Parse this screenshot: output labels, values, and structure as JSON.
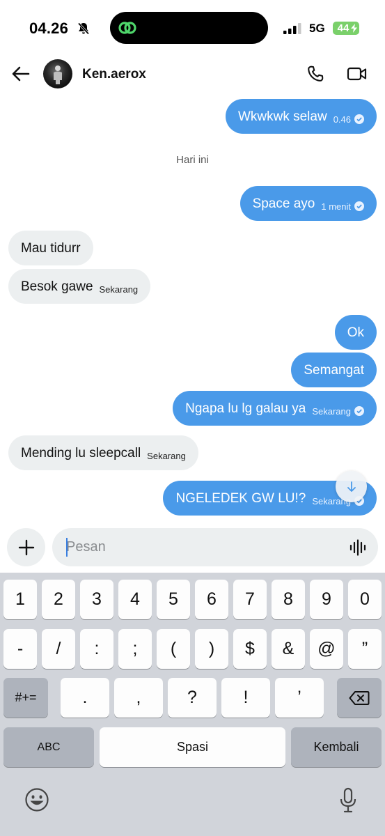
{
  "status_bar": {
    "time": "04.26",
    "network": "5G",
    "battery": "44"
  },
  "header": {
    "contact_name": "Ken.aerox"
  },
  "messages": [
    {
      "dir": "out",
      "text": "Wkwkwk selaw",
      "meta": "0.46",
      "check": true
    },
    {
      "dir": "out",
      "text": "Space ayo",
      "meta": "1 menit",
      "check": true
    },
    {
      "dir": "in",
      "text": "Mau tidurr",
      "meta": "",
      "check": false
    },
    {
      "dir": "in",
      "text": "Besok gawe",
      "meta": "Sekarang",
      "check": false
    },
    {
      "dir": "out",
      "text": "Ok",
      "meta": "",
      "check": false
    },
    {
      "dir": "out",
      "text": "Semangat",
      "meta": "",
      "check": false
    },
    {
      "dir": "out",
      "text": "Ngapa lu lg galau ya",
      "meta": "Sekarang",
      "check": true
    },
    {
      "dir": "in",
      "text": "Mending lu sleepcall",
      "meta": "Sekarang",
      "check": false
    },
    {
      "dir": "out",
      "text": "NGELEDEK GW LU!?",
      "meta": "Sekarang",
      "check": true
    }
  ],
  "day_separator": "Hari ini",
  "composer": {
    "placeholder": "Pesan"
  },
  "keyboard": {
    "row1": [
      "1",
      "2",
      "3",
      "4",
      "5",
      "6",
      "7",
      "8",
      "9",
      "0"
    ],
    "row2": [
      "-",
      "/",
      ":",
      ";",
      "(",
      ")",
      "$",
      "&",
      "@",
      "”"
    ],
    "row3_left": "#+=",
    "row3": [
      ".",
      ",",
      "?",
      "!",
      "’"
    ],
    "abc": "ABC",
    "space": "Spasi",
    "return": "Kembali"
  },
  "icons": {
    "status": [
      "bell-off-icon",
      "cellular-signal-icon",
      "charging-bolt-icon"
    ],
    "header": [
      "back-arrow-icon",
      "phone-icon",
      "video-camera-icon"
    ],
    "composer": [
      "plus-icon",
      "voice-wave-icon"
    ],
    "keyboard": [
      "backspace-icon",
      "emoji-icon",
      "microphone-icon"
    ],
    "chat": [
      "scroll-down-arrow-icon",
      "read-check-icon"
    ]
  },
  "colors": {
    "outgoing_bubble": "#4a9ae9",
    "incoming_bubble": "#eceff0",
    "keyboard_bg": "#d1d4da",
    "battery": "#7ad06a",
    "island_logo": "#4fd66b"
  }
}
